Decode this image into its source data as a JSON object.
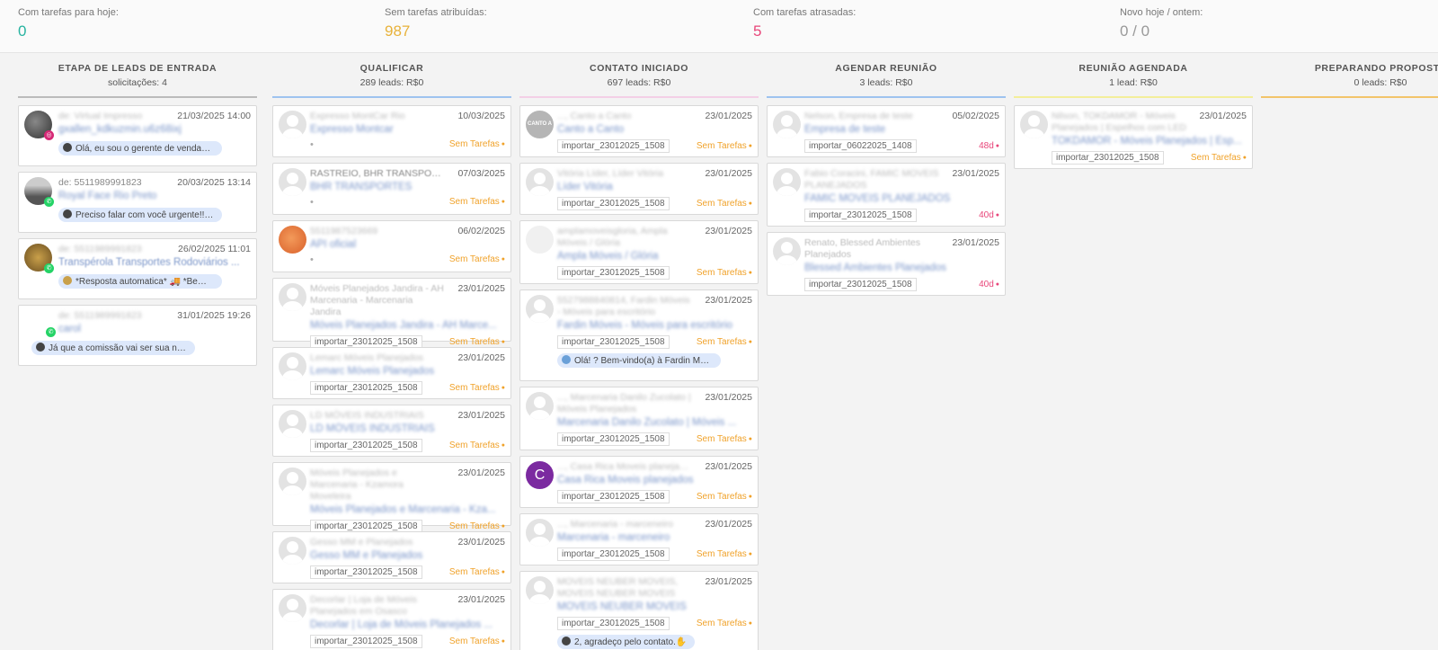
{
  "stats": [
    {
      "label": "Com tarefas para hoje:",
      "value": "0",
      "color": "#27b3a0"
    },
    {
      "label": "Sem tarefas atribuídas:",
      "value": "987",
      "color": "#e8b23a"
    },
    {
      "label": "Com tarefas atrasadas:",
      "value": "5",
      "color": "#e8467a"
    },
    {
      "label": "Novo hoje / ontem:",
      "value": "0 / 0",
      "color": "#999999"
    }
  ],
  "columns": [
    {
      "title": "ETAPA DE LEADS DE ENTRADA",
      "sub": "solicitações: 4",
      "color": "#bbbbbb"
    },
    {
      "title": "QUALIFICAR",
      "sub": "289 leads: R$0",
      "color": "#9ec3ef"
    },
    {
      "title": "CONTATO INICIADO",
      "sub": "697 leads: R$0",
      "color": "#f3cfe6"
    },
    {
      "title": "AGENDAR REUNIÃO",
      "sub": "3 leads: R$0",
      "color": "#9ec3ef"
    },
    {
      "title": "REUNIÃO AGENDADA",
      "sub": "1 lead: R$0",
      "color": "#f3ee9a"
    },
    {
      "title": "PREPARANDO PROPOSTA",
      "sub": "0 leads: R$0",
      "color": "#f2c46a"
    }
  ],
  "incoming": [
    {
      "who": "de: Virtual Impresso",
      "date": "21/03/2025 14:00",
      "name": "gxallen_kdkuzmin.u6z68ixj",
      "msg": "Olá, eu sou o gerente de vendas ..."
    },
    {
      "who": "de: 5511989991823",
      "date": "20/03/2025 13:14",
      "name": "Royal Face Rio Preto",
      "msg": "Preciso falar com você urgente!!!..."
    },
    {
      "who": "de: 5511989991823",
      "date": "26/02/2025 11:01",
      "name": "Transpérola Transportes Rodoviários ...",
      "msg": "*Resposta automatica* 🚚 *Bem-..."
    },
    {
      "who": "de: 5511989991823",
      "date": "31/01/2025 19:26",
      "name": "carol",
      "msg": "Já que a comissão vai ser sua na ..."
    }
  ],
  "qualificar": [
    {
      "who": "Expresso MontCar Rio",
      "date": "10/03/2025",
      "name": "Expresso Montcar",
      "tag": "",
      "tasks": "Sem Tarefas"
    },
    {
      "who": "RASTREIO, BHR TRANSPORTES",
      "date": "07/03/2025",
      "name": "BHR TRANSPORTES",
      "tag": "",
      "tasks": "Sem Tarefas"
    },
    {
      "who": "5511987523669",
      "date": "06/02/2025",
      "name": "API oficial",
      "tag": "",
      "tasks": "Sem Tarefas"
    },
    {
      "who": "Móveis Planejados Jandira - AH Marcenaria - Marcenaria Jandira",
      "date": "23/01/2025",
      "name": "Móveis Planejados Jandira - AH Marce...",
      "tag": "importar_23012025_1508",
      "tasks": "Sem Tarefas"
    },
    {
      "who": "Lemarc Móveis Planejados",
      "date": "23/01/2025",
      "name": "Lemarc Móveis Planejados",
      "tag": "importar_23012025_1508",
      "tasks": "Sem Tarefas"
    },
    {
      "who": "LD MÓVEIS INDUSTRIAIS",
      "date": "23/01/2025",
      "name": "LD MÓVEIS INDUSTRIAIS",
      "tag": "importar_23012025_1508",
      "tasks": "Sem Tarefas"
    },
    {
      "who": "Móveis Planejados e Marcenaria - Kzamora Moveleira",
      "date": "23/01/2025",
      "name": "Móveis Planejados e Marcenaria - Kza...",
      "tag": "importar_23012025_1508",
      "tasks": "Sem Tarefas"
    },
    {
      "who": "Gesso MM e Planejados",
      "date": "23/01/2025",
      "name": "Gesso MM e Planejados",
      "tag": "importar_23012025_1508",
      "tasks": "Sem Tarefas"
    },
    {
      "who": "Decorlar | Loja de Móveis Planejados em Osasco",
      "date": "23/01/2025",
      "name": "Decorlar | Loja de Móveis Planejados ...",
      "tag": "importar_23012025_1508",
      "tasks": "Sem Tarefas"
    }
  ],
  "contato": [
    {
      "who": "..., Canto a Canto",
      "date": "23/01/2025",
      "name": "Canto a Canto",
      "tag": "importar_23012025_1508",
      "tasks": "Sem Tarefas",
      "msg": ""
    },
    {
      "who": "Vitória Líder, Líder Vitória",
      "date": "23/01/2025",
      "name": "Líder Vitória",
      "tag": "importar_23012025_1508",
      "tasks": "Sem Tarefas",
      "msg": ""
    },
    {
      "who": "amplamoveisgloria, Ampla Móveis / Glória",
      "date": "23/01/2025",
      "name": "Ampla Móveis / Glória",
      "tag": "importar_23012025_1508",
      "tasks": "Sem Tarefas",
      "msg": ""
    },
    {
      "who": "5527988840814, Fardin Móveis - Móveis para escritório",
      "date": "23/01/2025",
      "name": "Fardin Móveis - Móveis para escritório",
      "tag": "importar_23012025_1508",
      "tasks": "Sem Tarefas",
      "msg": "Olá! ? Bem-vindo(a) à Fardin Móv..."
    },
    {
      "who": "..., Marcenaria Danilo Zucolato | Móveis Planejados",
      "date": "23/01/2025",
      "name": "Marcenaria Danilo Zucolato | Móveis ...",
      "tag": "importar_23012025_1508",
      "tasks": "Sem Tarefas",
      "msg": ""
    },
    {
      "who": "..., Casa Rica Moveis planejados",
      "date": "23/01/2025",
      "name": "Casa Rica Moveis planejados",
      "tag": "importar_23012025_1508",
      "tasks": "Sem Tarefas",
      "msg": ""
    },
    {
      "who": "..., Marcenaria - marceneiro",
      "date": "23/01/2025",
      "name": "Marcenaria - marceneiro",
      "tag": "importar_23012025_1508",
      "tasks": "Sem Tarefas",
      "msg": ""
    },
    {
      "who": "MOVEIS NEUBER MOVEIS, MOVEIS NEUBER MOVEIS",
      "date": "23/01/2025",
      "name": "MOVEIS NEUBER MOVEIS",
      "tag": "importar_23012025_1508",
      "tasks": "Sem Tarefas",
      "msg": "2, agradeço pelo contato.✋"
    }
  ],
  "agendar": [
    {
      "who": "Nelson, Empresa de teste",
      "date": "05/02/2025",
      "name": "Empresa de teste",
      "tag": "importar_06022025_1408",
      "late": "48d"
    },
    {
      "who": "Fabio Coracini, FAMIC MOVEIS PLANEJADOS",
      "date": "23/01/2025",
      "name": "FAMIC MOVEIS PLANEJADOS",
      "tag": "importar_23012025_1508",
      "late": "40d"
    },
    {
      "who": "Renato, Blessed Ambientes Planejados",
      "date": "23/01/2025",
      "name": "Blessed Ambientes Planejados",
      "tag": "importar_23012025_1508",
      "late": "40d"
    }
  ],
  "agendada": [
    {
      "who": "Nilson, TOKDAMOR - Móveis Planejados | Espelhos com LED",
      "date": "23/01/2025",
      "name": "TOKDAMOR - Móveis Planejados | Esp...",
      "tag": "importar_23012025_1508",
      "tasks": "Sem Tarefas"
    }
  ],
  "canto_avatar_text": "CANTO A CANTO",
  "casa_avatar_letter": "C"
}
